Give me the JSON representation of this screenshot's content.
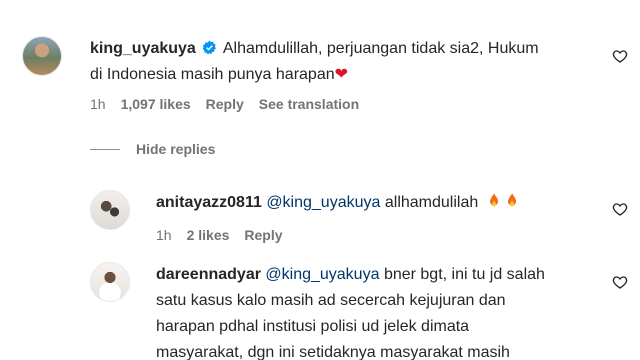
{
  "comments": [
    {
      "username": "king_uyakuya",
      "verified": true,
      "text_line1": "Alhamdulillah, perjuangan tidak sia2, Hukum",
      "text_line2": "di Indonesia masih punya harapan",
      "emoji": "❤",
      "time": "1h",
      "likes": "1,097 likes",
      "reply_label": "Reply",
      "translation_label": "See translation"
    }
  ],
  "hide_replies_label": "Hide replies",
  "replies": [
    {
      "username": "anitayazz0811",
      "mention": "@king_uyakuya",
      "text": "allhamdulilah",
      "time": "1h",
      "likes": "2 likes",
      "reply_label": "Reply"
    },
    {
      "username": "dareennadyar",
      "mention": "@king_uyakuya",
      "text_line1": "bner bgt, ini tu jd salah",
      "text_line2": "satu kasus kalo masih ad secercah kejujuran dan",
      "text_line3": "harapan pdhal institusi polisi ud jelek dimata",
      "text_line4": "masyarakat, dgn ini setidaknya masyarakat masih"
    }
  ],
  "colors": {
    "text": "#262626",
    "secondary": "#737373",
    "mention": "#00376b",
    "verified": "#0095f6",
    "heart": "#e0132e"
  },
  "icons": {
    "verified": "verified-badge-icon",
    "like": "heart-outline-icon",
    "fire": "fire-emoji-icon"
  }
}
